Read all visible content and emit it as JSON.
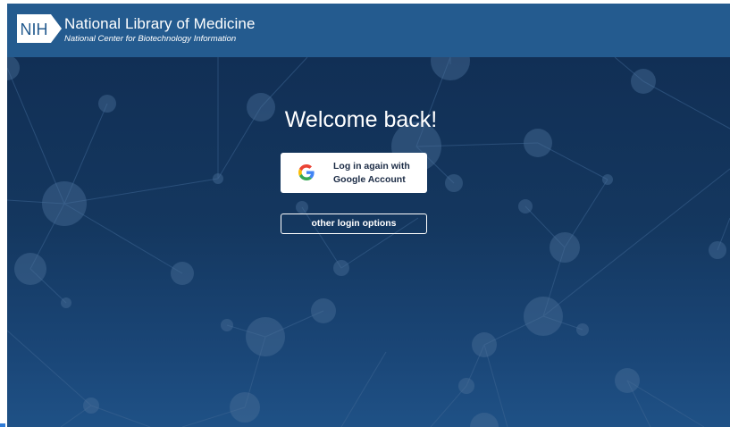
{
  "header": {
    "logo_text": "NIH",
    "org_name": "National Library of Medicine",
    "org_subtitle": "National Center for Biotechnology Information"
  },
  "main": {
    "welcome_title": "Welcome back!",
    "google_button": {
      "line1": "Log in again with",
      "line2": "Google Account",
      "icon": "google-g-icon"
    },
    "other_login_label": "other login options"
  },
  "colors": {
    "header_bg": "#245b8f",
    "background": "#153a63",
    "button_bg": "#ffffff",
    "button_text": "#1b2b45",
    "google_blue": "#4285F4",
    "google_red": "#EA4335",
    "google_yellow": "#FBBC05",
    "google_green": "#34A853"
  }
}
